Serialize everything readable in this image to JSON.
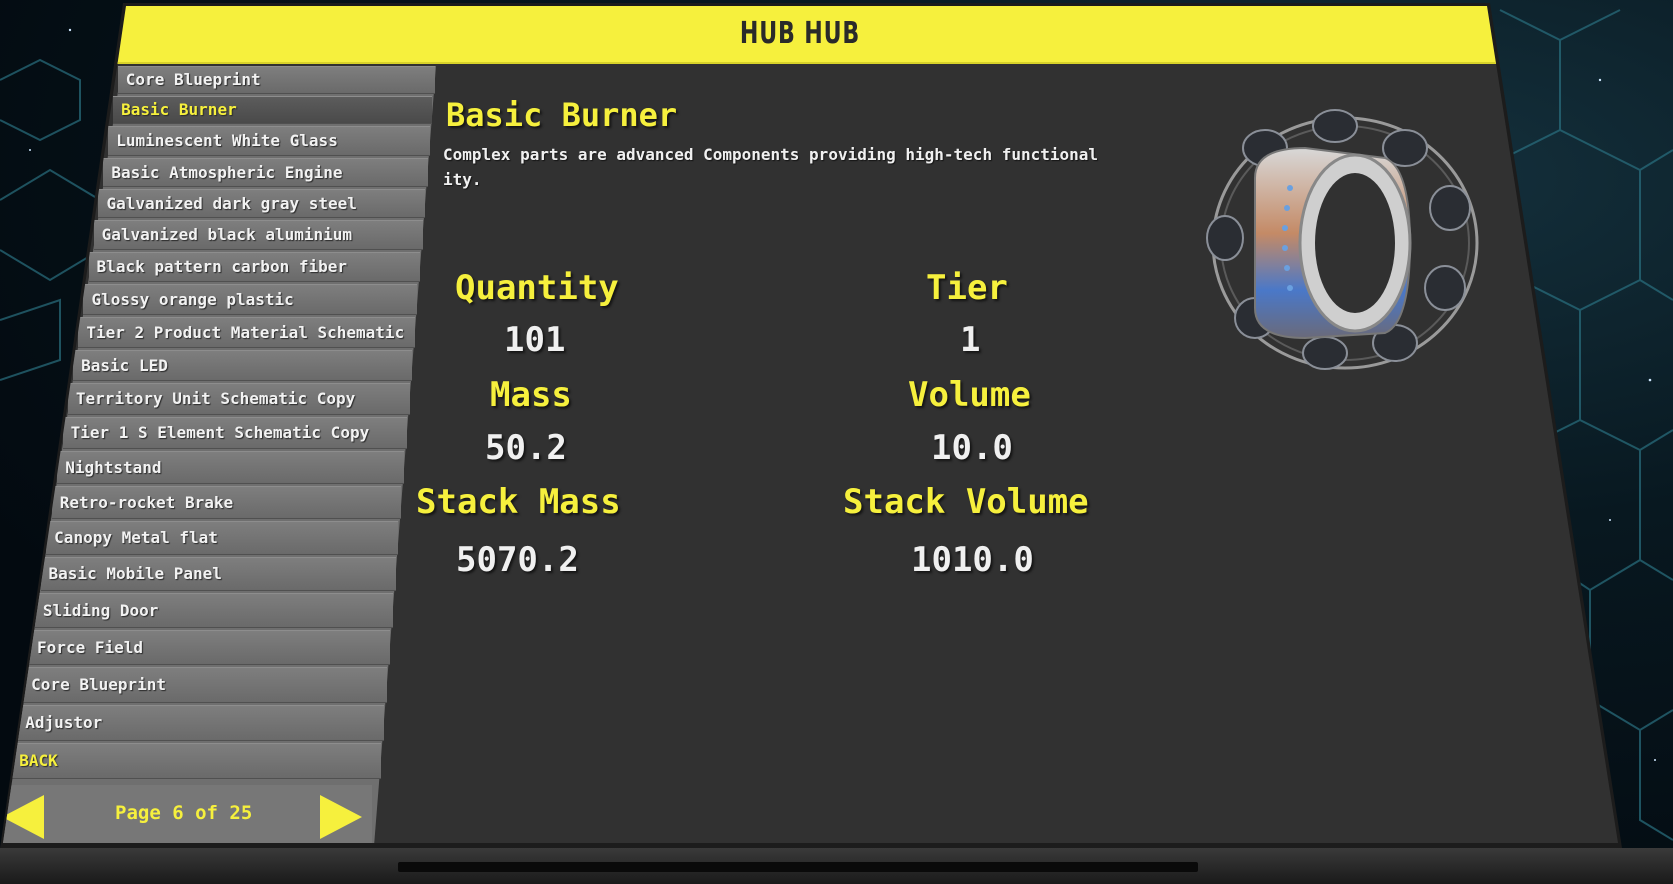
{
  "window": {
    "title": "HUB HUB"
  },
  "sidebar": {
    "items": [
      {
        "label": "Core Blueprint",
        "active": false
      },
      {
        "label": "Basic Burner",
        "active": true
      },
      {
        "label": "Luminescent White Glass",
        "active": false
      },
      {
        "label": "Basic Atmospheric Engine",
        "active": false
      },
      {
        "label": "Galvanized dark gray steel",
        "active": false
      },
      {
        "label": "Galvanized black aluminium",
        "active": false
      },
      {
        "label": "Black pattern carbon fiber",
        "active": false
      },
      {
        "label": "Glossy orange plastic",
        "active": false
      },
      {
        "label": "Tier 2 Product Material Schematic",
        "active": false
      },
      {
        "label": "Basic LED",
        "active": false
      },
      {
        "label": "Territory Unit Schematic Copy",
        "active": false
      },
      {
        "label": "Tier 1 S Element Schematic Copy",
        "active": false
      },
      {
        "label": "Nightstand",
        "active": false
      },
      {
        "label": "Retro-rocket Brake",
        "active": false
      },
      {
        "label": "Canopy Metal flat",
        "active": false
      },
      {
        "label": "Basic Mobile Panel",
        "active": false
      },
      {
        "label": "Sliding Door",
        "active": false
      },
      {
        "label": "Force Field",
        "active": false
      },
      {
        "label": "Core Blueprint",
        "active": false
      },
      {
        "label": "Adjustor",
        "active": false
      }
    ],
    "back_label": "BACK"
  },
  "pager": {
    "text": "Page 6 of 25",
    "current": 6,
    "total": 25
  },
  "detail": {
    "title": "Basic Burner",
    "description": "Complex parts are advanced Components providing high-tech functionality.",
    "stats": {
      "quantity_label": "Quantity",
      "quantity_value": "101",
      "tier_label": "Tier",
      "tier_value": "1",
      "mass_label": "Mass",
      "mass_value": "50.2",
      "volume_label": "Volume",
      "volume_value": "10.0",
      "stack_mass_label": "Stack Mass",
      "stack_mass_value": "5070.2",
      "stack_volume_label": "Stack Volume",
      "stack_volume_value": "1010.0"
    },
    "image_icon": "burner-engine-icon"
  },
  "colors": {
    "accent": "#f6f03d",
    "panel": "#313131",
    "sidebar": "#6f6f6f",
    "text": "#f0f0f0"
  }
}
